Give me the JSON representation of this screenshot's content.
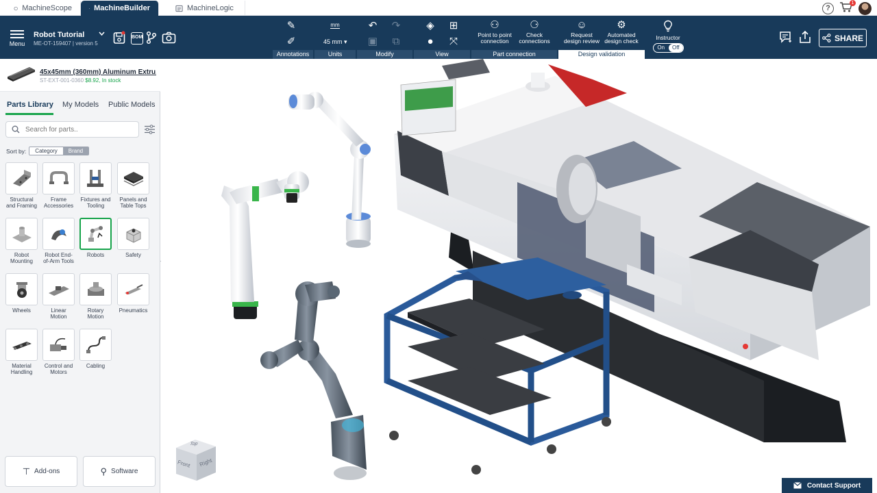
{
  "browser_tabs": [
    {
      "label": "MachineScope",
      "active": false
    },
    {
      "label": "MachineBuilder",
      "active": true
    },
    {
      "label": "MachineLogic",
      "active": false
    }
  ],
  "cart_count": "1",
  "menu_label": "Menu",
  "project": {
    "title": "Robot Tutorial",
    "subtitle": "ME-OT-159407 | version 5"
  },
  "toolbar": {
    "groups": [
      "Annotations",
      "Units",
      "Modify",
      "View",
      "Part connection",
      "Design validation"
    ],
    "units_value": "45 mm",
    "units_icon_text": "mm",
    "bom_icon_text": "BOM",
    "point_to_point": "Point to point connection",
    "check_connections": "Check connections",
    "request_review": "Request design review",
    "automated_check": "Automated design check",
    "instructor": "Instructor",
    "toggle_on": "On",
    "toggle_off": "Off",
    "share": "SHARE"
  },
  "selected_part": {
    "name": "45x45mm (360mm) Aluminum Extru...",
    "sku": "ST-EXT-001-0360",
    "price": "$8.92, In stock"
  },
  "sidebar": {
    "tabs": [
      "Parts Library",
      "My Models",
      "Public Models"
    ],
    "search_placeholder": "Search for parts..",
    "sort_label": "Sort by:",
    "sort_options": [
      "Category",
      "Brand"
    ],
    "categories": [
      {
        "label": "Structural and Framing"
      },
      {
        "label": "Frame Accessories"
      },
      {
        "label": "Fixtures and Tooling"
      },
      {
        "label": "Panels and Table Tops"
      },
      {
        "label": "Robot Mounting"
      },
      {
        "label": "Robot End-of-Arm Tools"
      },
      {
        "label": "Robots",
        "highlighted": true
      },
      {
        "label": "Safety"
      },
      {
        "label": "Wheels"
      },
      {
        "label": "Linear Motion"
      },
      {
        "label": "Rotary Motion"
      },
      {
        "label": "Pneumatics"
      },
      {
        "label": "Material Handling"
      },
      {
        "label": "Control and Motors"
      },
      {
        "label": "Cabling"
      }
    ],
    "addons": "Add-ons",
    "software": "Software"
  },
  "viewcube": {
    "top": "Top",
    "front": "Front",
    "right": "Right"
  },
  "support": "Contact Support",
  "colors": {
    "navy": "#183a5a",
    "green": "#16a34a",
    "frame_blue": "#2a5a9a",
    "red": "#c62828"
  }
}
